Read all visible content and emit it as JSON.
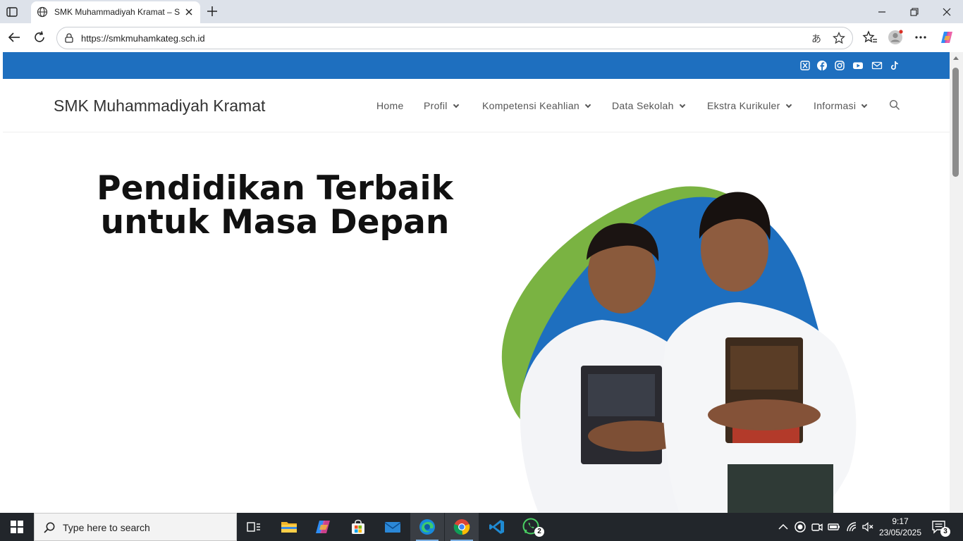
{
  "browser": {
    "tab_title": "SMK Muhammadiyah Kramat – Se",
    "url": "https://smkmuhamkateg.sch.id",
    "read_aloud_glyph": "あ"
  },
  "site": {
    "title": "SMK Muhammadiyah Kramat",
    "menu": [
      {
        "label": "Home",
        "has_dropdown": false
      },
      {
        "label": "Profil",
        "has_dropdown": true
      },
      {
        "label": "Kompetensi Keahlian",
        "has_dropdown": true
      },
      {
        "label": "Data Sekolah",
        "has_dropdown": true
      },
      {
        "label": "Ekstra Kurikuler",
        "has_dropdown": true
      },
      {
        "label": "Informasi",
        "has_dropdown": true
      }
    ],
    "social_icons": [
      "x-twitter-icon",
      "facebook-icon",
      "instagram-icon",
      "youtube-icon",
      "mail-icon",
      "tiktok-icon"
    ],
    "hero": {
      "line1": "Pendidikan Terbaik",
      "line2": "untuk Masa Depan"
    },
    "colors": {
      "topbar": "#1e6fbf",
      "blob_green": "#7ab342",
      "blob_blue": "#1e6fbf"
    }
  },
  "taskbar": {
    "search_placeholder": "Type here to search",
    "whatsapp_badge": "2",
    "time": "9:17",
    "date": "23/05/2025",
    "notification_count": "3"
  }
}
